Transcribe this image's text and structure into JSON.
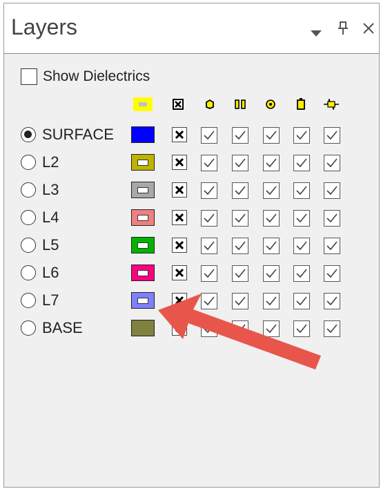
{
  "panel": {
    "title": "Layers",
    "dropdown_icon": "chevron-down-icon",
    "pin_icon": "pin-icon",
    "close_icon": "close-icon"
  },
  "show_dielectrics": {
    "label": "Show Dielectrics",
    "checked": false
  },
  "column_headers": [
    {
      "name": "color-column-icon",
      "accent": "#ffff00"
    },
    {
      "name": "x-box-column-icon"
    },
    {
      "name": "shape-column-icon"
    },
    {
      "name": "pads-column-icon"
    },
    {
      "name": "via-column-icon"
    },
    {
      "name": "component-column-icon"
    },
    {
      "name": "connector-column-icon"
    }
  ],
  "layers": [
    {
      "label": "SURFACE",
      "selected": true,
      "color": "#0000ff",
      "inner": false
    },
    {
      "label": "L2",
      "selected": false,
      "color": "#bdb400",
      "inner": true
    },
    {
      "label": "L3",
      "selected": false,
      "color": "#a8a8a8",
      "inner": true
    },
    {
      "label": "L4",
      "selected": false,
      "color": "#f08080",
      "inner": true
    },
    {
      "label": "L5",
      "selected": false,
      "color": "#00b400",
      "inner": true
    },
    {
      "label": "L6",
      "selected": false,
      "color": "#ff0080",
      "inner": true
    },
    {
      "label": "L7",
      "selected": false,
      "color": "#8080ff",
      "inner": true
    },
    {
      "label": "BASE",
      "selected": false,
      "color": "#808040",
      "inner": false
    }
  ],
  "annotation": {
    "color": "#e8564b"
  }
}
